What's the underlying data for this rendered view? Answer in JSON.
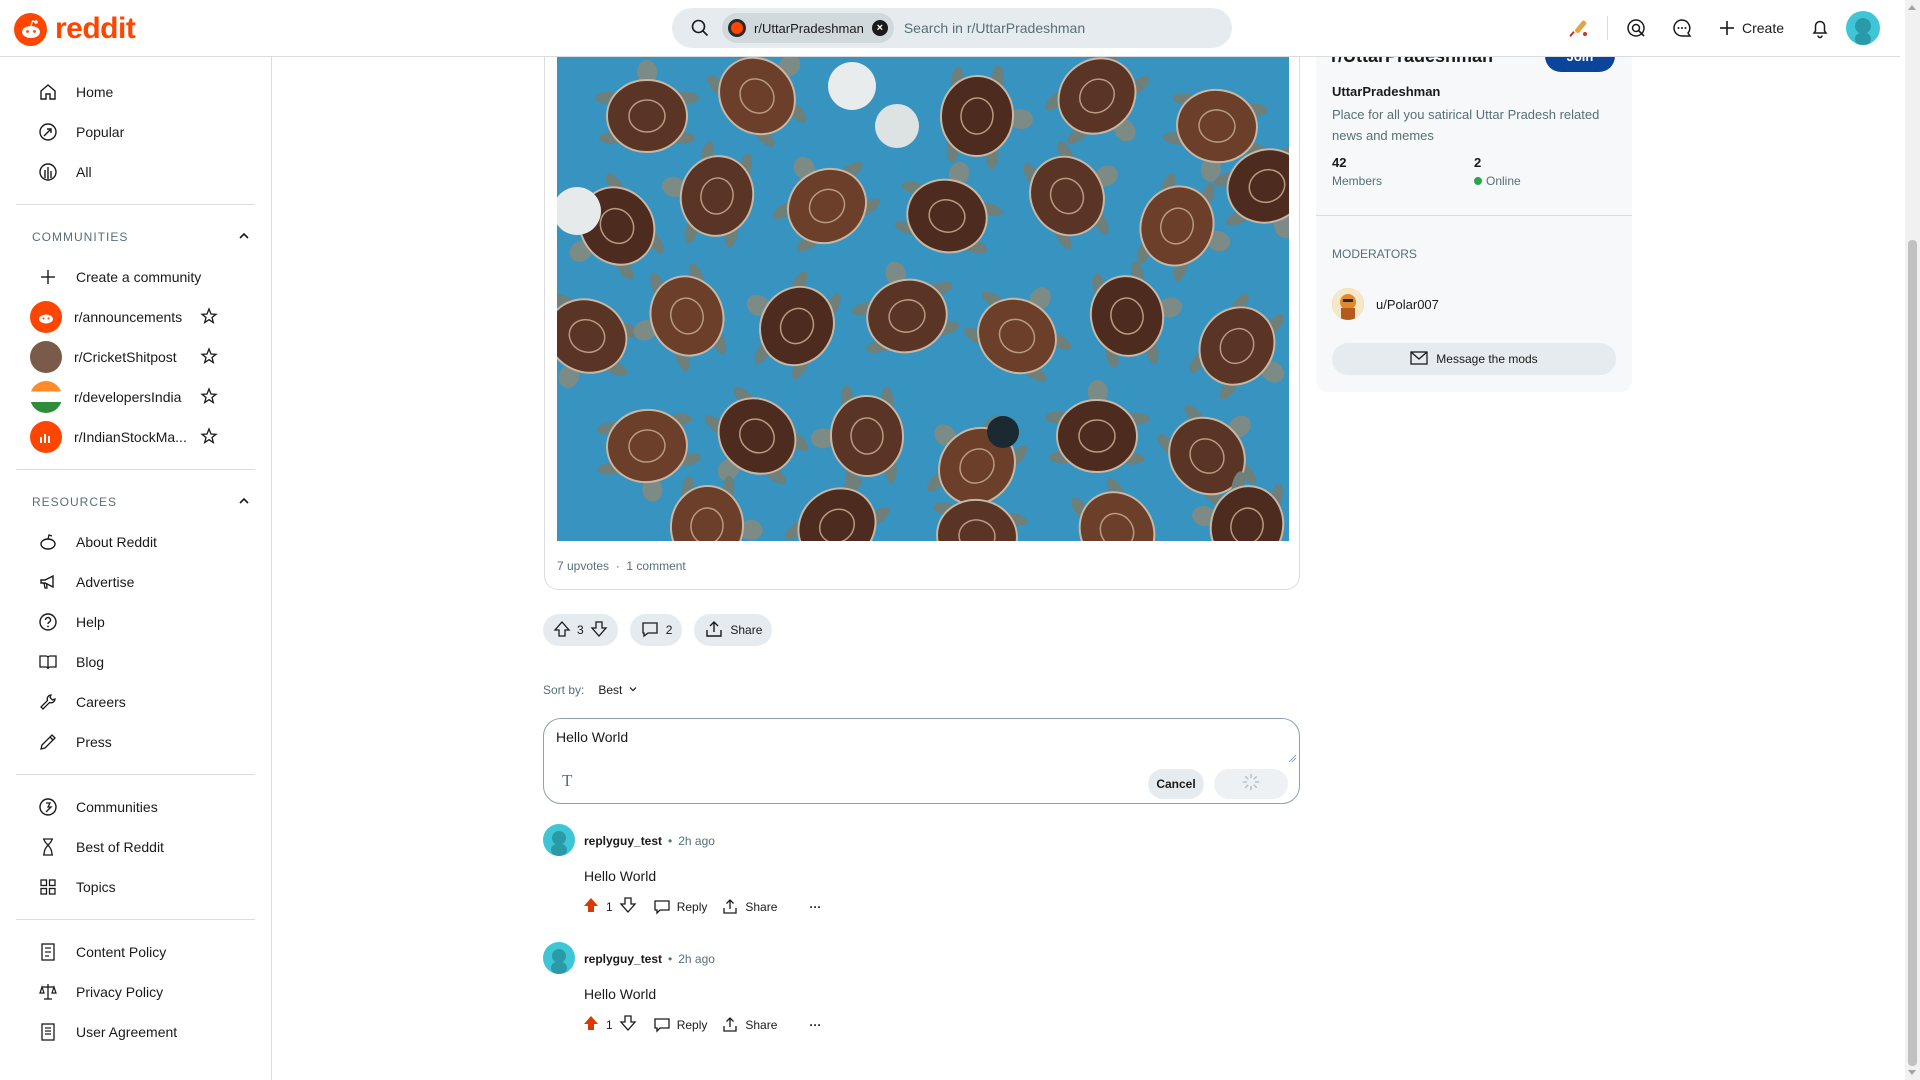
{
  "brand": {
    "name": "reddit",
    "accent": "#ff4500"
  },
  "search": {
    "community_chip": "r/UttarPradeshman",
    "placeholder": "Search in r/UttarPradeshman"
  },
  "header": {
    "create_label": "Create"
  },
  "sidebar": {
    "nav": [
      {
        "label": "Home",
        "icon": "home-icon"
      },
      {
        "label": "Popular",
        "icon": "popular-icon"
      },
      {
        "label": "All",
        "icon": "all-icon"
      }
    ],
    "communities_heading": "COMMUNITIES",
    "create_community": "Create a community",
    "communities": [
      {
        "label": "r/announcements",
        "color": "#ff4500"
      },
      {
        "label": "r/CricketShitpost",
        "color": "#7a5a48"
      },
      {
        "label": "r/developersIndia",
        "color": "#2f8c3b"
      },
      {
        "label": "r/IndianStockMa...",
        "color": "#ff4500"
      }
    ],
    "resources_heading": "RESOURCES",
    "resources": [
      {
        "label": "About Reddit",
        "icon": "reddit-alien-icon"
      },
      {
        "label": "Advertise",
        "icon": "megaphone-icon"
      },
      {
        "label": "Help",
        "icon": "help-icon"
      },
      {
        "label": "Blog",
        "icon": "book-icon"
      },
      {
        "label": "Careers",
        "icon": "wrench-icon"
      },
      {
        "label": "Press",
        "icon": "pen-icon"
      }
    ],
    "explore": [
      {
        "label": "Communities",
        "icon": "communities-icon"
      },
      {
        "label": "Best of Reddit",
        "icon": "hourglass-icon"
      },
      {
        "label": "Topics",
        "icon": "topics-icon"
      }
    ],
    "policies": [
      {
        "label": "Content Policy",
        "icon": "content-policy-icon"
      },
      {
        "label": "Privacy Policy",
        "icon": "scale-icon"
      },
      {
        "label": "User Agreement",
        "icon": "document-icon"
      }
    ]
  },
  "post": {
    "upvotes_text": "7 upvotes",
    "comments_text": "1 comment",
    "vote_count": "3",
    "comment_count": "2",
    "share_label": "Share"
  },
  "sort": {
    "label": "Sort by:",
    "value": "Best"
  },
  "composer": {
    "value": "Hello World",
    "format_glyph": "T",
    "cancel_label": "Cancel"
  },
  "comments": [
    {
      "user": "replyguy_test",
      "time": "2h ago",
      "body": "Hello World",
      "score": "1",
      "reply_label": "Reply",
      "share_label": "Share",
      "more": "···"
    },
    {
      "user": "replyguy_test",
      "time": "2h ago",
      "body": "Hello World",
      "score": "1",
      "reply_label": "Reply",
      "share_label": "Share",
      "more": "···"
    }
  ],
  "community_panel": {
    "title": "r/UttarPradeshman",
    "join_label": "Join",
    "name": "UttarPradeshman",
    "description": "Place for all you satirical Uttar Pradesh related news and memes",
    "members_count": "42",
    "members_label": "Members",
    "online_count": "2",
    "online_label": "Online",
    "moderators_heading": "MODERATORS",
    "moderator": "u/Polar007",
    "message_mods_label": "Message the mods",
    "join_color": "#0a449b"
  }
}
